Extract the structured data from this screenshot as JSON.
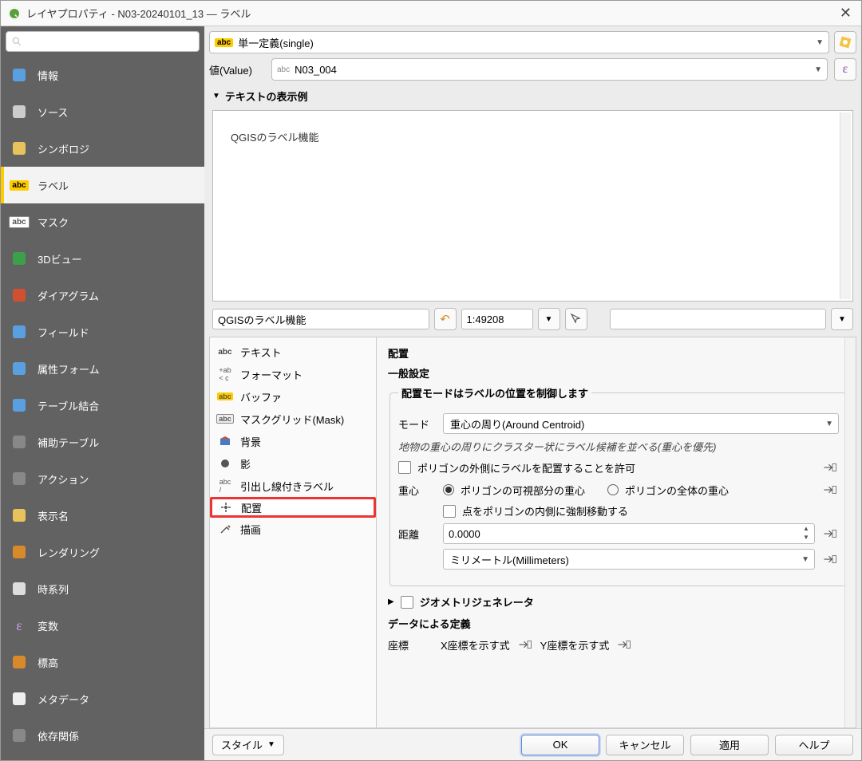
{
  "window": {
    "title": "レイヤプロパティ - N03-20240101_13 — ラベル"
  },
  "sidebar": {
    "items": [
      {
        "label": "情報",
        "icon": "info"
      },
      {
        "label": "ソース",
        "icon": "source"
      },
      {
        "label": "シンボロジ",
        "icon": "symbology"
      },
      {
        "label": "ラベル",
        "icon": "label",
        "active": true
      },
      {
        "label": "マスク",
        "icon": "mask"
      },
      {
        "label": "3Dビュー",
        "icon": "3d"
      },
      {
        "label": "ダイアグラム",
        "icon": "diagram"
      },
      {
        "label": "フィールド",
        "icon": "fields"
      },
      {
        "label": "属性フォーム",
        "icon": "form"
      },
      {
        "label": "テーブル結合",
        "icon": "join"
      },
      {
        "label": "補助テーブル",
        "icon": "aux"
      },
      {
        "label": "アクション",
        "icon": "action"
      },
      {
        "label": "表示名",
        "icon": "display"
      },
      {
        "label": "レンダリング",
        "icon": "render"
      },
      {
        "label": "時系列",
        "icon": "temporal"
      },
      {
        "label": "変数",
        "icon": "var"
      },
      {
        "label": "標高",
        "icon": "elev"
      },
      {
        "label": "メタデータ",
        "icon": "meta"
      },
      {
        "label": "依存関係",
        "icon": "dep"
      }
    ]
  },
  "labeling": {
    "mode": "単一定義(single)",
    "value_label": "値(Value)",
    "value_field": "N03_004",
    "preview_header": "テキストの表示例",
    "preview_text": "QGISのラベル機能",
    "preview_input": "QGISのラベル機能",
    "scale": "1:49208"
  },
  "tabs": {
    "items": [
      {
        "label": "テキスト",
        "icon": "abc"
      },
      {
        "label": "フォーマット",
        "icon": "format"
      },
      {
        "label": "バッファ",
        "icon": "buffer"
      },
      {
        "label": "マスクグリッド(Mask)",
        "icon": "maskgrid"
      },
      {
        "label": "背景",
        "icon": "bg"
      },
      {
        "label": "影",
        "icon": "shadow"
      },
      {
        "label": "引出し線付きラベル",
        "icon": "callout"
      },
      {
        "label": "配置",
        "icon": "placement",
        "selected": true
      },
      {
        "label": "描画",
        "icon": "render"
      }
    ]
  },
  "placement": {
    "title": "配置",
    "general_title": "一般設定",
    "mode_legend": "配置モードはラベルの位置を制御します",
    "mode_label": "モード",
    "mode_value": "重心の周り(Around Centroid)",
    "mode_hint": "地物の重心の周りにクラスター状にラベル候補を並べる(重心を優先)",
    "allow_outside": "ポリゴンの外側にラベルを配置することを許可",
    "centroid_label": "重心",
    "centroid_visible": "ポリゴンの可視部分の重心",
    "centroid_whole": "ポリゴンの全体の重心",
    "force_inside": "点をポリゴンの内側に強制移動する",
    "distance_label": "距離",
    "distance_value": "0.0000",
    "distance_unit": "ミリメートル(Millimeters)",
    "geom_gen": "ジオメトリジェネレータ",
    "data_defined": "データによる定義",
    "coord_label": "座標",
    "coord_x": "X座標を示す式",
    "coord_y": "Y座標を示す式"
  },
  "footer": {
    "style": "スタイル",
    "ok": "OK",
    "cancel": "キャンセル",
    "apply": "適用",
    "help": "ヘルプ"
  }
}
